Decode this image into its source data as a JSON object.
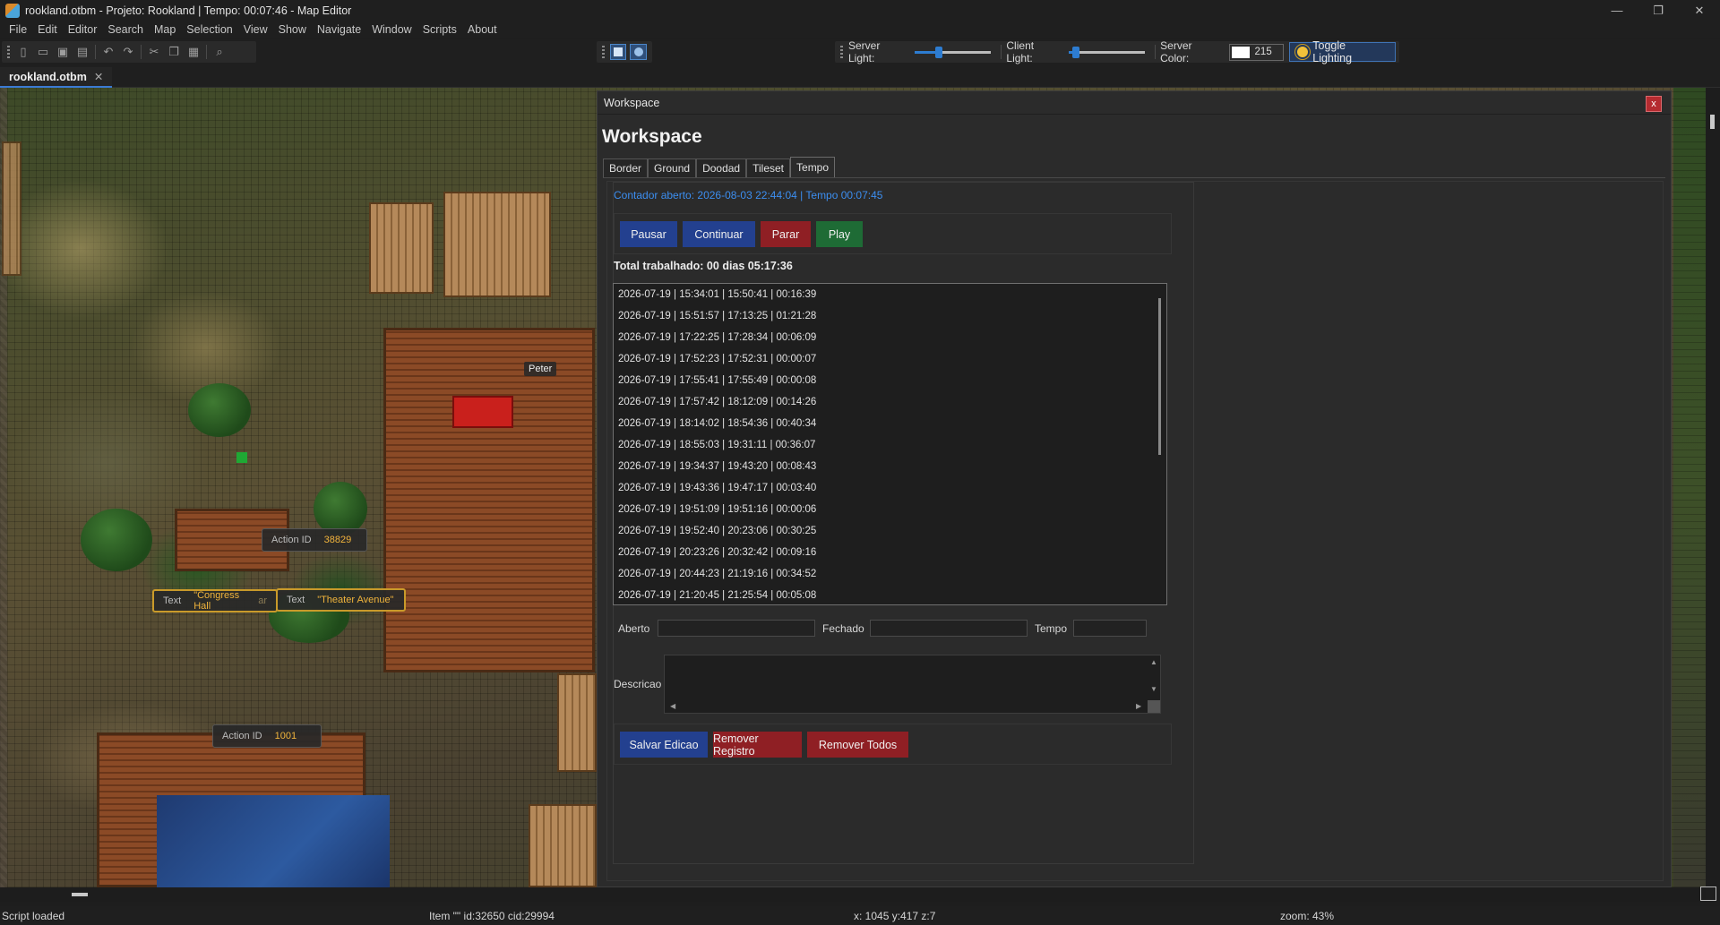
{
  "window": {
    "title": "rookland.otbm - Projeto: Rookland | Tempo: 00:07:46 - Map Editor",
    "controls": {
      "minimize": "—",
      "maximize": "❐",
      "close": "✕"
    }
  },
  "menu": [
    "File",
    "Edit",
    "Editor",
    "Search",
    "Map",
    "Selection",
    "View",
    "Show",
    "Navigate",
    "Window",
    "Scripts",
    "About"
  ],
  "toolbar": {
    "server_light_label": "Server Light:",
    "client_light_label": "Client Light:",
    "server_color_label": "Server Color:",
    "server_color_value": "215",
    "server_light_level": 0.3,
    "client_light_level": 0.05,
    "toggle_lighting_label": "Toggle Lighting"
  },
  "doc_tab": {
    "label": "rookland.otbm",
    "close": "✕"
  },
  "map": {
    "npc_name": "Peter",
    "tags": [
      {
        "key": "Action ID",
        "value": "38829"
      },
      {
        "key": "Text",
        "value": "\"Congress Hall",
        "suffix": "ar"
      },
      {
        "key": "Text",
        "value": "\"Theater Avenue\""
      },
      {
        "key": "Action ID",
        "value": "1001"
      }
    ]
  },
  "workspace": {
    "window_title": "Workspace",
    "close_label": "x",
    "heading": "Workspace",
    "tabs": [
      "Border",
      "Ground",
      "Doodad",
      "Tileset",
      "Tempo"
    ],
    "active_tab": "Tempo",
    "counter_text": "Contador aberto: 2026-08-03 22:44:04 | Tempo 00:07:45",
    "buttons": {
      "pause": "Pausar",
      "resume": "Continuar",
      "stop": "Parar",
      "play": "Play"
    },
    "total_text": "Total trabalhado: 00 dias 05:17:36",
    "records": [
      "2026-07-19 | 15:34:01 | 15:50:41 | 00:16:39",
      "2026-07-19 | 15:51:57 | 17:13:25 | 01:21:28",
      "2026-07-19 | 17:22:25 | 17:28:34 | 00:06:09",
      "2026-07-19 | 17:52:23 | 17:52:31 | 00:00:07",
      "2026-07-19 | 17:55:41 | 17:55:49 | 00:00:08",
      "2026-07-19 | 17:57:42 | 18:12:09 | 00:14:26",
      "2026-07-19 | 18:14:02 | 18:54:36 | 00:40:34",
      "2026-07-19 | 18:55:03 | 19:31:11 | 00:36:07",
      "2026-07-19 | 19:34:37 | 19:43:20 | 00:08:43",
      "2026-07-19 | 19:43:36 | 19:47:17 | 00:03:40",
      "2026-07-19 | 19:51:09 | 19:51:16 | 00:00:06",
      "2026-07-19 | 19:52:40 | 20:23:06 | 00:30:25",
      "2026-07-19 | 20:23:26 | 20:32:42 | 00:09:16",
      "2026-07-19 | 20:44:23 | 21:19:16 | 00:34:52",
      "2026-07-19 | 21:20:45 | 21:25:54 | 00:05:08"
    ],
    "fields": {
      "opened_label": "Aberto",
      "closed_label": "Fechado",
      "time_label": "Tempo",
      "description_label": "Descricao"
    },
    "edit_buttons": {
      "save": "Salvar Edicao",
      "remove": "Remover Registro",
      "remove_all": "Remover Todos"
    }
  },
  "status": {
    "message": "Script loaded",
    "item": "Item \"\" id:32650 cid:29994",
    "coords": "x: 1045 y:417 z:7",
    "zoom": "zoom: 43%"
  }
}
